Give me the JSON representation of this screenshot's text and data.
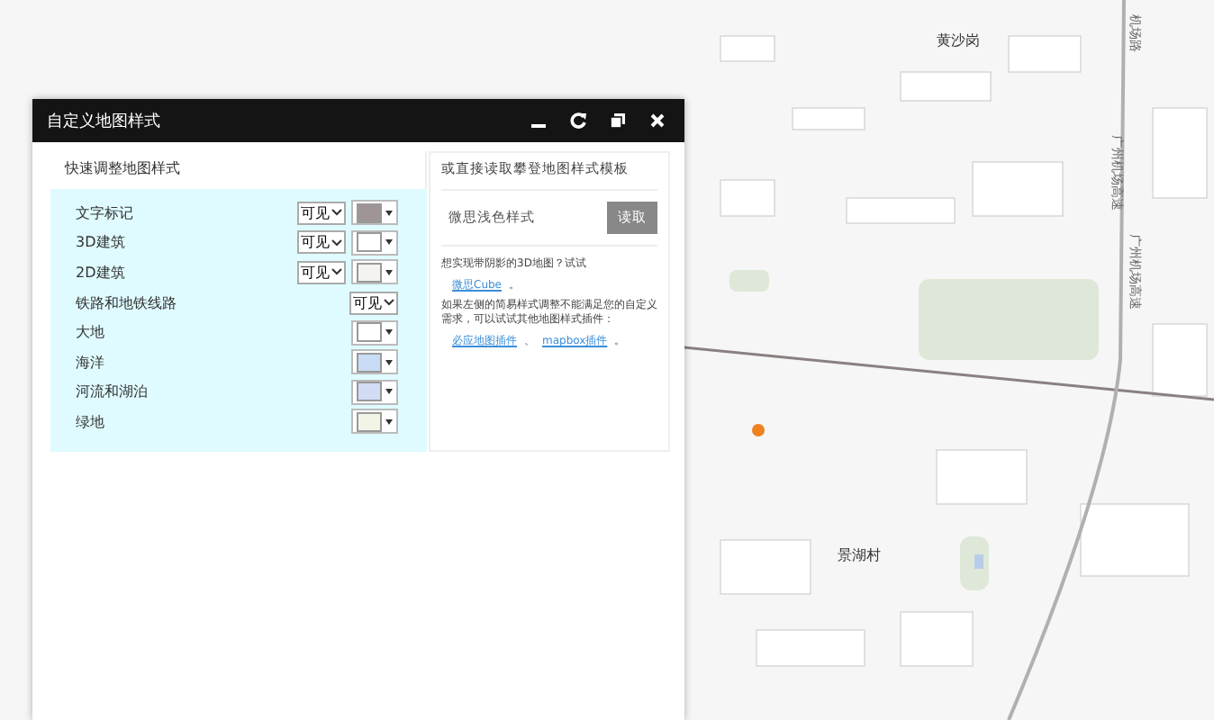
{
  "map": {
    "labels": [
      {
        "text": "黄沙岗",
        "kind": "area"
      },
      {
        "text": "机场路",
        "kind": "road"
      },
      {
        "text": "广州机场高速",
        "kind": "road"
      },
      {
        "text": "广州机场高速",
        "kind": "road"
      },
      {
        "text": "景湖村",
        "kind": "area"
      }
    ]
  },
  "window": {
    "title": "自定义地图样式"
  },
  "quick_panel": {
    "heading": "快速调整地图样式",
    "rows": [
      {
        "label": "文字标记",
        "visibility": "可见",
        "color": "#a09595"
      },
      {
        "label": "3D建筑",
        "visibility": "可见",
        "color": "#ffffff"
      },
      {
        "label": "2D建筑",
        "visibility": "可见",
        "color": "#f5f3ef"
      },
      {
        "label": "铁路和地铁线路",
        "visibility": "可见"
      },
      {
        "label": "大地",
        "color": "#ffffff"
      },
      {
        "label": "海洋",
        "color": "#c8dcf5"
      },
      {
        "label": "河流和湖泊",
        "color": "#d2dcf5"
      },
      {
        "label": "绿地",
        "color": "#f2f4e6"
      }
    ]
  },
  "template_panel": {
    "heading": "或直接读取攀登地图样式模板",
    "input_value": "微思浅色样式",
    "button": "读取",
    "note_1": "想实现带阴影的3D地图？试试",
    "link_1": "微思Cube",
    "end_1": "。",
    "note_2": "如果左侧的简易样式调整不能满足您的自定义需求，可以试试其他地图样式插件：",
    "link_2": "必应地图插件",
    "sep": "、",
    "link_3": "mapbox插件",
    "end_2": "。"
  }
}
